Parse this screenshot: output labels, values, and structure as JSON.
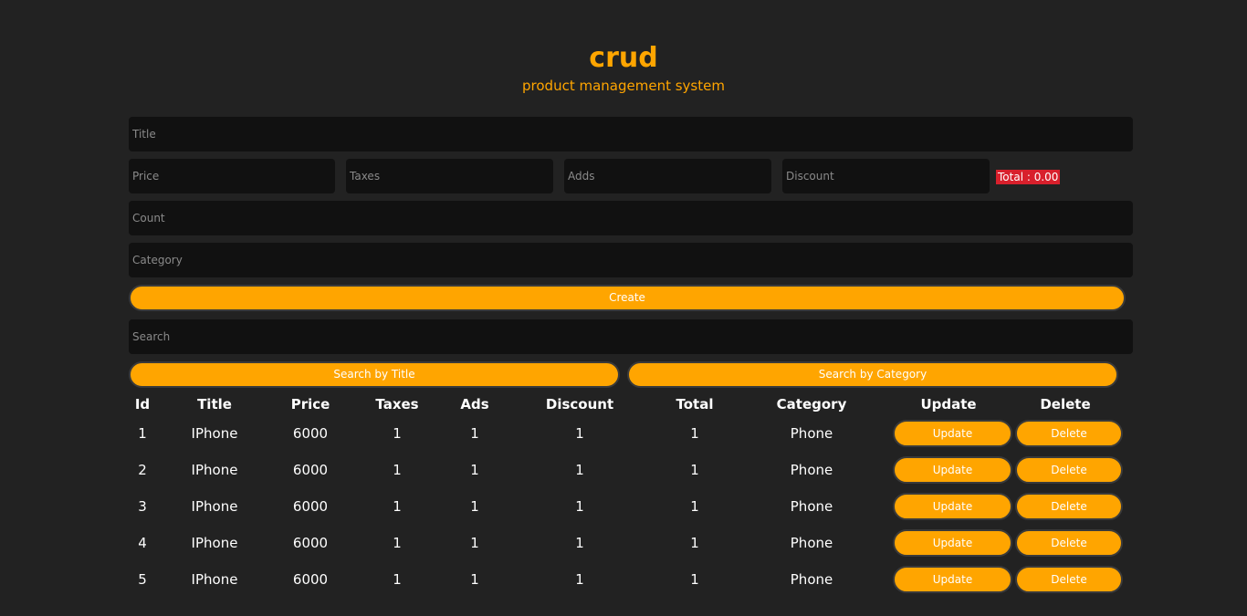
{
  "header": {
    "title": "crud",
    "subtitle": "product management system"
  },
  "form": {
    "title_placeholder": "Title",
    "price_placeholder": "Price",
    "taxes_placeholder": "Taxes",
    "ads_placeholder": "Adds",
    "discount_placeholder": "Discount",
    "total_label": "Total : 0.00",
    "count_placeholder": "Count",
    "category_placeholder": "Category",
    "create_label": "Create"
  },
  "search": {
    "placeholder": "Search",
    "by_title_label": "Search by Title",
    "by_category_label": "Search by Category"
  },
  "table": {
    "headers": [
      "Id",
      "Title",
      "Price",
      "Taxes",
      "Ads",
      "Discount",
      "Total",
      "Category",
      "Update",
      "Delete"
    ],
    "update_label": "Update",
    "delete_label": "Delete",
    "rows": [
      {
        "id": "1",
        "title": "IPhone",
        "price": "6000",
        "taxes": "1",
        "ads": "1",
        "discount": "1",
        "total": "1",
        "category": "Phone"
      },
      {
        "id": "2",
        "title": "IPhone",
        "price": "6000",
        "taxes": "1",
        "ads": "1",
        "discount": "1",
        "total": "1",
        "category": "Phone"
      },
      {
        "id": "3",
        "title": "IPhone",
        "price": "6000",
        "taxes": "1",
        "ads": "1",
        "discount": "1",
        "total": "1",
        "category": "Phone"
      },
      {
        "id": "4",
        "title": "IPhone",
        "price": "6000",
        "taxes": "1",
        "ads": "1",
        "discount": "1",
        "total": "1",
        "category": "Phone"
      },
      {
        "id": "5",
        "title": "IPhone",
        "price": "6000",
        "taxes": "1",
        "ads": "1",
        "discount": "1",
        "total": "1",
        "category": "Phone"
      }
    ]
  },
  "colors": {
    "background": "#222222",
    "accent": "#ffa500",
    "field_background": "#111111",
    "total_badge": "#d8202c"
  }
}
